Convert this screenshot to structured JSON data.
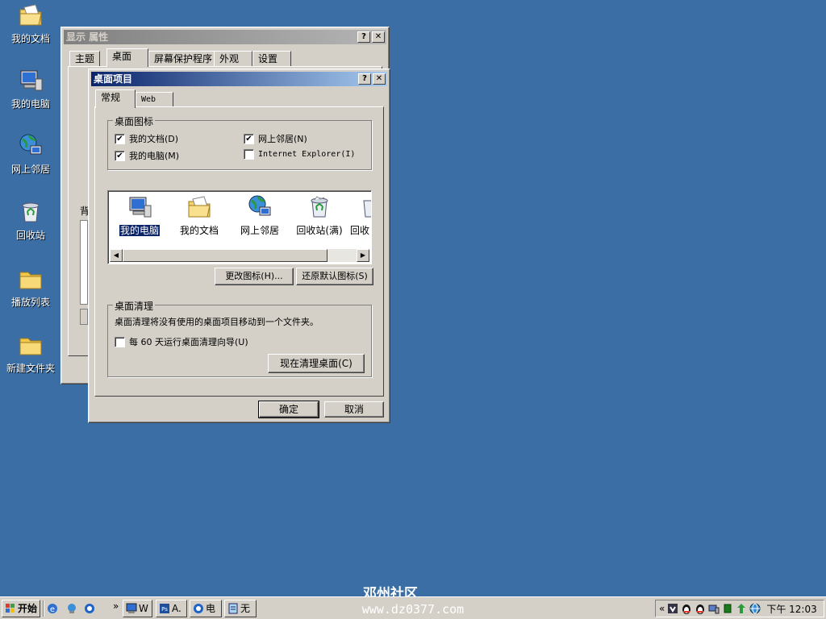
{
  "desktop": {
    "icons": [
      {
        "label": "我的文档",
        "icon": "my-documents-icon"
      },
      {
        "label": "我的电脑",
        "icon": "my-computer-icon"
      },
      {
        "label": "网上邻居",
        "icon": "network-places-icon"
      },
      {
        "label": "回收站",
        "icon": "recycle-bin-icon"
      },
      {
        "label": "播放列表",
        "icon": "folder-icon"
      },
      {
        "label": "新建文件夹",
        "icon": "folder-icon"
      }
    ]
  },
  "display_props": {
    "title": "显示 属性",
    "help": "?",
    "close": "✕",
    "tabs": [
      "主题",
      "桌面",
      "屏幕保护程序",
      "外观",
      "设置"
    ],
    "bg_label": "背"
  },
  "dialog": {
    "title": "桌面项目",
    "help": "?",
    "close": "✕",
    "tabs": [
      "常规",
      "Web"
    ],
    "icons_group": "桌面图标",
    "checkboxes": [
      {
        "label": "我的文档(D)",
        "checked": true
      },
      {
        "label": "网上邻居(N)",
        "checked": true
      },
      {
        "label": "我的电脑(M)",
        "checked": true
      },
      {
        "label": "Internet Explorer(I)",
        "checked": false
      }
    ],
    "list_items": [
      "我的电脑",
      "我的文档",
      "网上邻居",
      "回收站(满)",
      "回收"
    ],
    "change_icon": "更改图标(H)...",
    "restore_default": "还原默认图标(S)",
    "cleanup_group": "桌面清理",
    "cleanup_desc": "桌面清理将没有使用的桌面项目移动到一个文件夹。",
    "cleanup_check": "每 60 天运行桌面清理向导(U)",
    "cleanup_checked": false,
    "cleanup_now": "现在清理桌面(C)",
    "ok": "确定",
    "cancel": "取消"
  },
  "taskbar": {
    "start": "开始",
    "chevron": "»",
    "tasks": [
      "W",
      "A.",
      "电",
      "无"
    ],
    "tray_chevron": "«",
    "time": "下午 12:03"
  },
  "watermark": {
    "line1": "邓州社区",
    "line2": "www.dz0377.com"
  },
  "colors": {
    "desktop": "#3a6ea5",
    "active_title": "#0a246a",
    "face": "#d4d0c8"
  }
}
